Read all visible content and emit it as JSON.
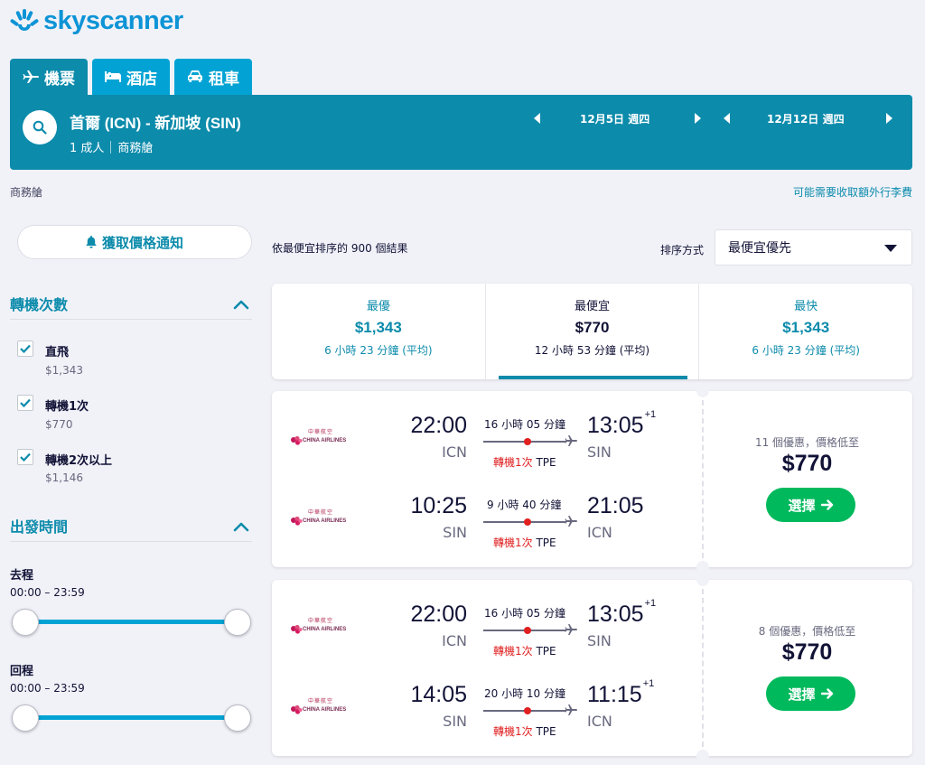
{
  "brand": {
    "name": "skyscanner",
    "color": "#0d94d6"
  },
  "tabs": [
    {
      "label": "機票",
      "icon": "plane-icon",
      "active": true
    },
    {
      "label": "酒店",
      "icon": "bed-icon",
      "active": false
    },
    {
      "label": "租車",
      "icon": "car-icon",
      "active": false
    }
  ],
  "search": {
    "route": "首爾 (ICN) - 新加坡 (SIN)",
    "passengers": "1 成人",
    "cabin": "商務艙",
    "depart_date": "12月5日 週四",
    "return_date": "12月12日 週四"
  },
  "top_info": {
    "cabin_label": "商務艙",
    "baggage_note": "可能需要收取額外行李費"
  },
  "sidebar": {
    "price_alert": "獲取價格通知",
    "stops_title": "轉機次數",
    "stops": [
      {
        "label": "直飛",
        "price": "$1,343",
        "checked": true
      },
      {
        "label": "轉機1次",
        "price": "$770",
        "checked": true
      },
      {
        "label": "轉機2次以上",
        "price": "$1,146",
        "checked": true
      }
    ],
    "time_title": "出發時間",
    "outbound_label": "去程",
    "outbound_range": "00:00 – 23:59",
    "return_label": "回程",
    "return_range": "00:00 – 23:59"
  },
  "results": {
    "count_text": "依最便宜排序的 900 個結果",
    "sort_label": "排序方式",
    "sort_value": "最便宜優先"
  },
  "summary": [
    {
      "title": "最優",
      "price": "$1,343",
      "duration": "6 小時 23 分鐘 (平均)",
      "active": false
    },
    {
      "title": "最便宜",
      "price": "$770",
      "duration": "12 小時 53 分鐘 (平均)",
      "active": true
    },
    {
      "title": "最快",
      "price": "$1,343",
      "duration": "6 小時 23 分鐘 (平均)",
      "active": false
    }
  ],
  "cards": [
    {
      "legs": [
        {
          "airline_cn": "中華航空",
          "airline": "CHINA AIRLINES",
          "dep_time": "22:00",
          "dep_code": "ICN",
          "arr_time": "13:05",
          "arr_plus": "+1",
          "arr_code": "SIN",
          "duration": "16 小時 05 分鐘",
          "stops": "轉機1次",
          "via": "TPE"
        },
        {
          "airline_cn": "中華航空",
          "airline": "CHINA AIRLINES",
          "dep_time": "10:25",
          "dep_code": "SIN",
          "arr_time": "21:05",
          "arr_plus": "",
          "arr_code": "ICN",
          "duration": "9 小時 40 分鐘",
          "stops": "轉機1次",
          "via": "TPE"
        }
      ],
      "deals": "11 個優惠，價格低至",
      "price": "$770",
      "select": "選擇"
    },
    {
      "legs": [
        {
          "airline_cn": "中華航空",
          "airline": "CHINA AIRLINES",
          "dep_time": "22:00",
          "dep_code": "ICN",
          "arr_time": "13:05",
          "arr_plus": "+1",
          "arr_code": "SIN",
          "duration": "16 小時 05 分鐘",
          "stops": "轉機1次",
          "via": "TPE"
        },
        {
          "airline_cn": "中華航空",
          "airline": "CHINA AIRLINES",
          "dep_time": "14:05",
          "dep_code": "SIN",
          "arr_time": "11:15",
          "arr_plus": "+1",
          "arr_code": "ICN",
          "duration": "20 小時 10 分鐘",
          "stops": "轉機1次",
          "via": "TPE"
        }
      ],
      "deals": "8 個優惠，價格低至",
      "price": "$770",
      "select": "選擇"
    }
  ]
}
